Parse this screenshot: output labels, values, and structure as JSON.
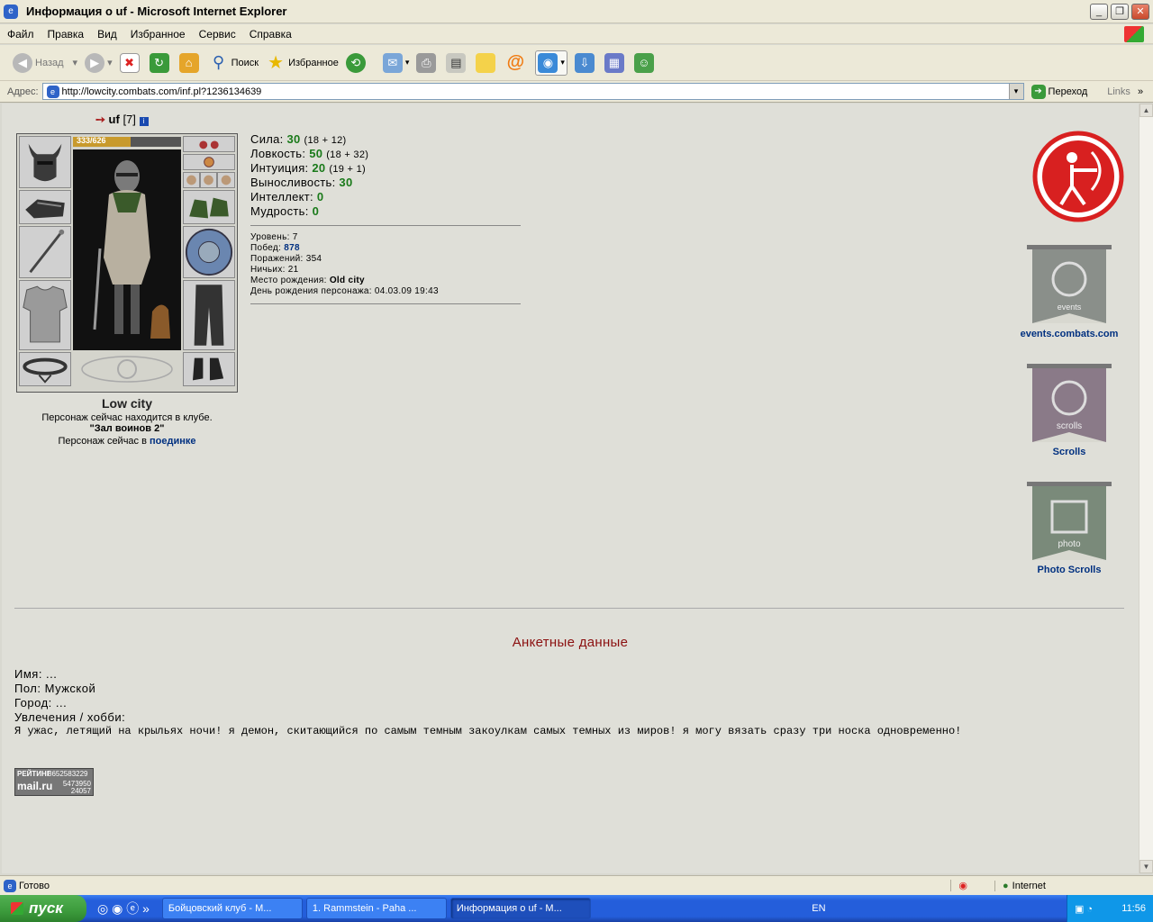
{
  "window": {
    "title": "Информация о uf - Microsoft Internet Explorer"
  },
  "menu": [
    "Файл",
    "Правка",
    "Вид",
    "Избранное",
    "Сервис",
    "Справка"
  ],
  "toolbar": {
    "back": "Назад",
    "search": "Поиск",
    "favorites": "Избранное"
  },
  "address": {
    "label": "Адрес:",
    "url": "http://lowcity.combats.com/inf.pl?1236134639",
    "go": "Переход",
    "links": "Links"
  },
  "character": {
    "name": "uf",
    "level": "[7]",
    "hp_text": "333/626",
    "hp_fraction": 0.53,
    "city": "Low city",
    "club_text": "Персонаж сейчас находится в клубе.",
    "club_room": "\"Зал воинов 2\"",
    "fight_prefix": "Персонаж сейчас в",
    "fight_link": "поединке"
  },
  "stats": [
    {
      "label": "Сила:",
      "value": "30",
      "extra": "(18 + 12)"
    },
    {
      "label": "Ловкость:",
      "value": "50",
      "extra": "(18 + 32)"
    },
    {
      "label": "Интуиция:",
      "value": "20",
      "extra": "(19 + 1)"
    },
    {
      "label": "Выносливость:",
      "value": "30",
      "extra": ""
    },
    {
      "label": "Интеллект:",
      "value": "0",
      "extra": ""
    },
    {
      "label": "Мудрость:",
      "value": "0",
      "extra": ""
    }
  ],
  "info": [
    {
      "label": "Уровень:",
      "value": "7"
    },
    {
      "label": "Побед:",
      "value": "878"
    },
    {
      "label": "Поражений:",
      "value": "354"
    },
    {
      "label": "Ничьих:",
      "value": "21"
    },
    {
      "label": "Место рождения:",
      "value": "Old city"
    },
    {
      "label": "День рождения персонажа:",
      "value": "04.03.09 19:43"
    }
  ],
  "right_links": {
    "events_text": "events",
    "events": "events.combats.com",
    "scrolls_text": "scrolls",
    "scrolls": "Scrolls",
    "photo_text": "photo",
    "photo": "Photo Scrolls"
  },
  "profile": {
    "title": "Анкетные данные",
    "name": "Имя: ...",
    "gender": "Пол: Мужской",
    "city": "Город: ...",
    "hobby_label": "Увлечения / хобби:",
    "hobby_text": "Я ужас, летящий на крыльях ночи! я демон, скитающийся по самым темным закоулкам самых темных из миров! я могу вязать сразу три носка одновременно!"
  },
  "counter": {
    "label": "РЕЙТИНГ",
    "n1": "8652583229",
    "brand": "mail.ru",
    "n2": "5473950",
    "n3": "24057"
  },
  "status": {
    "text": "Готово",
    "zone": "Internet"
  },
  "taskbar": {
    "start": "пуск",
    "tasks": [
      "Бойцовский клуб - M...",
      "1. Rammstein - Paha ...",
      "Информация о uf - M..."
    ],
    "lang": "EN",
    "clock": "11:56"
  },
  "colors": {
    "accent_red": "#8b1010",
    "link_blue": "#003080",
    "stat_green": "#1a7a1a"
  }
}
